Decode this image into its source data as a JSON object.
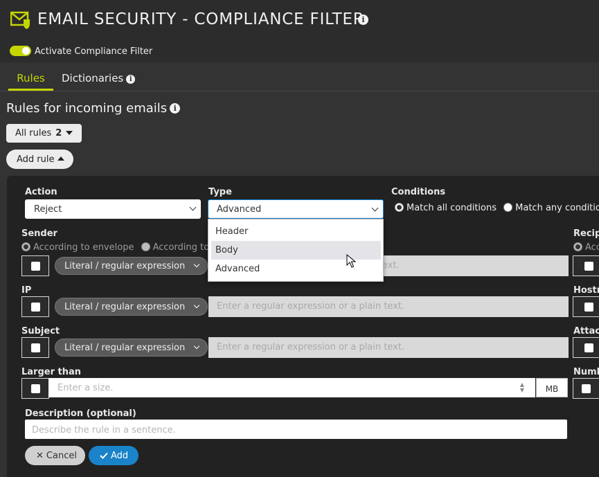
{
  "header": {
    "title": "EMAIL SECURITY - COMPLIANCE FILTER",
    "accent_color": "#c3d600",
    "toggle_label": "Activate Compliance Filter",
    "toggle_on": true
  },
  "tabs": [
    {
      "label": "Rules",
      "active": true
    },
    {
      "label": "Dictionaries",
      "active": false
    }
  ],
  "section": {
    "title": "Rules for incoming emails",
    "all_rules_label": "All rules",
    "all_rules_count": "2",
    "add_rule_label": "Add rule"
  },
  "form": {
    "action_label": "Action",
    "action_value": "Reject",
    "type_label": "Type",
    "type_value": "Advanced",
    "conditions_label": "Conditions",
    "conditions_options": [
      "Match all conditions",
      "Match any conditions"
    ],
    "sender_label": "Sender",
    "sender_options": [
      "According to envelope",
      "According to h"
    ],
    "recipient_label": "Recipi",
    "recipient_option": "Acc",
    "sender_text_visible": "ext.",
    "ip_label": "IP",
    "hostname_label": "Hostn",
    "subject_label": "Subject",
    "attachment_label": "Attac",
    "larger_than_label": "Larger than",
    "number_label": "Numb",
    "mode_value": "Literal / regular expression",
    "text_placeholder": "Enter a regular expression or a plain text.",
    "size_placeholder": "Enter a size.",
    "size_unit": "MB",
    "description_label": "Description (optional)",
    "description_placeholder": "Describe the rule in a sentence.",
    "cancel_label": "Cancel",
    "add_label": "Add"
  },
  "type_dropdown": {
    "options": [
      "Header",
      "Body",
      "Advanced"
    ],
    "hovered": "Body"
  },
  "colors": {
    "primary_button": "#1a83c9",
    "background": "#333333",
    "panel": "#222222"
  }
}
